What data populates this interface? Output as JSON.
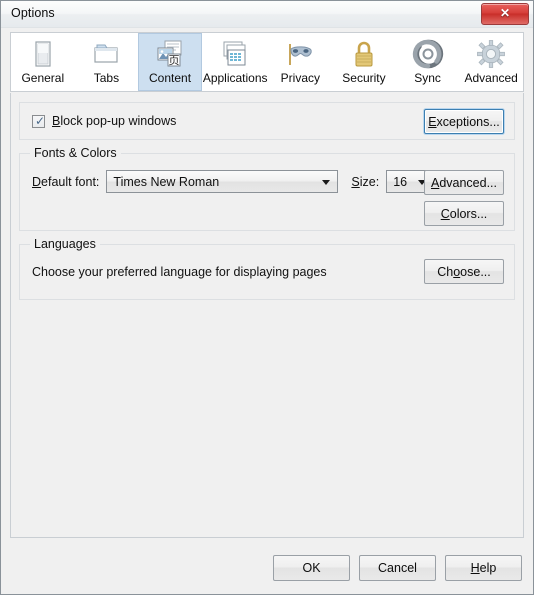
{
  "window": {
    "title": "Options",
    "close_label": "✕",
    "close_icon": "close-icon"
  },
  "tabs": [
    {
      "label": "General",
      "icon": "general-icon",
      "selected": false
    },
    {
      "label": "Tabs",
      "icon": "tabs-icon",
      "selected": false
    },
    {
      "label": "Content",
      "icon": "content-icon",
      "selected": true
    },
    {
      "label": "Applications",
      "icon": "applications-icon",
      "selected": false
    },
    {
      "label": "Privacy",
      "icon": "privacy-mask-icon",
      "selected": false
    },
    {
      "label": "Security",
      "icon": "padlock-icon",
      "selected": false
    },
    {
      "label": "Sync",
      "icon": "sync-arrows-icon",
      "selected": false
    },
    {
      "label": "Advanced",
      "icon": "gear-icon",
      "selected": false
    }
  ],
  "content": {
    "popup": {
      "checkbox_label_pre": "B",
      "checkbox_label_post": "lock pop-up windows",
      "checked": true,
      "exceptions_pre": "E",
      "exceptions_post": "xceptions..."
    },
    "fonts": {
      "legend": "Fonts & Colors",
      "font_label_pre": "D",
      "font_label_post": "efault font:",
      "font_value": "Times New Roman",
      "size_label_pre": "S",
      "size_label_post": "ize:",
      "size_value": "16",
      "advanced_pre": "A",
      "advanced_post": "dvanced...",
      "colors_pre": "C",
      "colors_post": "olors..."
    },
    "languages": {
      "legend": "Languages",
      "description": "Choose your preferred language for displaying pages",
      "choose_pre": "Ch",
      "choose_mid": "o",
      "choose_post": "ose..."
    }
  },
  "footer": {
    "ok": "OK",
    "cancel": "Cancel",
    "help_pre": "H",
    "help_post": "elp"
  },
  "colors": {
    "selected_tab": "#cddff0",
    "close_button": "#d63e39",
    "focus_ring": "#3c7fb1",
    "dialog_bg": "#f0f0f0"
  }
}
